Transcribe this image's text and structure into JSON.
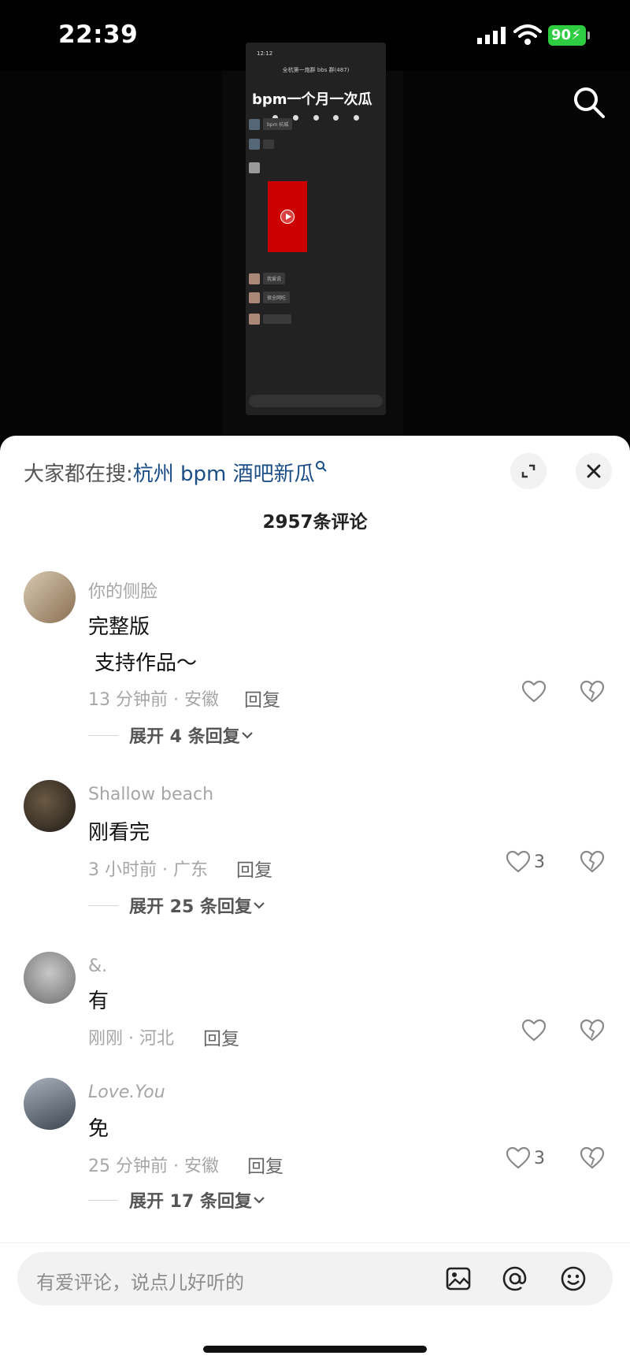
{
  "status_bar": {
    "time": "22:39",
    "battery": "90"
  },
  "video": {
    "phone_time": "12:12",
    "group_name": "全杭第一炮群 bbs 群(487)",
    "title_overlay": "bpm一个月一次瓜",
    "bubble_1": "bpm 杭城",
    "bubble_2": "我爱说",
    "bubble_3": "很全网吃"
  },
  "sheet": {
    "hot_search_prefix": "大家都在搜:",
    "hot_search_term": "杭州 bpm 酒吧新瓜",
    "comment_count": "2957条评论"
  },
  "comments": [
    {
      "user": "你的侧脸",
      "text": "完整版",
      "text2": "  支持作品～",
      "meta": "13 分钟前 · 安徽",
      "reply": "回复",
      "likes": "",
      "expand": "展开 4 条回复",
      "avatar_color": "#c9b8a0"
    },
    {
      "user": "Shallow beach",
      "text": "刚看完",
      "meta": "3 小时前 · 广东",
      "reply": "回复",
      "likes": "3",
      "expand": "展开 25 条回复",
      "avatar_color": "#3a3226"
    },
    {
      "user": "&.",
      "text": "有",
      "meta": "刚刚 · 河北",
      "reply": "回复",
      "likes": "",
      "expand": "",
      "avatar_color": "#9a9a9a"
    },
    {
      "user": "Love.You",
      "text": "免",
      "meta": "25 分钟前 · 安徽",
      "reply": "回复",
      "likes": "3",
      "expand": "展开 17 条回复",
      "avatar_color": "#7f8a96"
    }
  ],
  "input": {
    "placeholder": "有爱评论，说点儿好听的"
  },
  "colors": {
    "link": "#1b4e86",
    "battery": "#2ecc40",
    "secondary_text": "#a6a6a6"
  },
  "icons": [
    "search-icon",
    "expand-icon",
    "close-icon",
    "heart-icon",
    "broken-heart-icon",
    "image-icon",
    "at-icon",
    "emoji-icon",
    "chevron-down-icon"
  ]
}
